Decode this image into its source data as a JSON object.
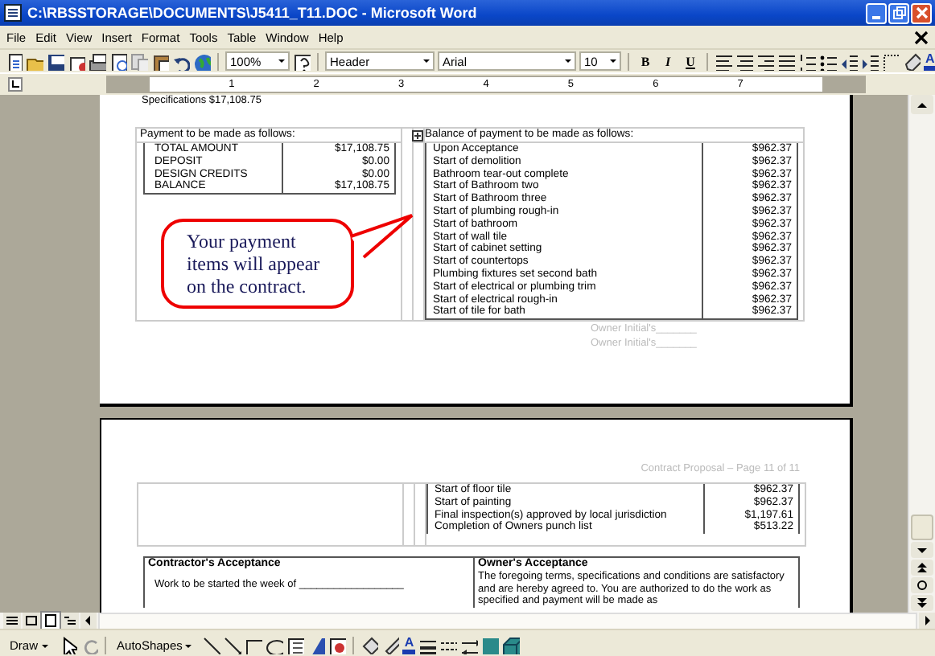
{
  "window": {
    "title": "C:\\RBSSTORAGE\\DOCUMENTS\\J5411_T11.DOC - Microsoft Word"
  },
  "menu": [
    "File",
    "Edit",
    "View",
    "Insert",
    "Format",
    "Tools",
    "Table",
    "Window",
    "Help"
  ],
  "toolbar": {
    "zoom": "100%",
    "style": "Header",
    "font": "Arial",
    "size": "10",
    "format_buttons": [
      "B",
      "I",
      "U"
    ],
    "font_color_label": "A"
  },
  "ruler": {
    "numbers": [
      "1",
      "2",
      "3",
      "4",
      "5",
      "6",
      "7"
    ]
  },
  "page1": {
    "specifications": "Specifications   $17,108.75",
    "payment_heading": "Payment to be made as follows:",
    "payment_rows": [
      {
        "label": "TOTAL AMOUNT",
        "amount": "$17,108.75"
      },
      {
        "label": "DEPOSIT",
        "amount": "$0.00"
      },
      {
        "label": "DESIGN CREDITS",
        "amount": "$0.00"
      },
      {
        "label": "BALANCE",
        "amount": "$17,108.75"
      }
    ],
    "balance_heading": "Balance of payment to be made as follows:",
    "balance_rows": [
      {
        "label": "Upon Acceptance",
        "amount": "$962.37"
      },
      {
        "label": "Start of demolition",
        "amount": "$962.37"
      },
      {
        "label": "Bathroom tear-out complete",
        "amount": "$962.37"
      },
      {
        "label": "Start of Bathroom two",
        "amount": "$962.37"
      },
      {
        "label": "Start of Bathroom three",
        "amount": "$962.37"
      },
      {
        "label": "Start of plumbing rough-in",
        "amount": "$962.37"
      },
      {
        "label": "Start of bathroom",
        "amount": "$962.37"
      },
      {
        "label": "Start of wall tile",
        "amount": "$962.37"
      },
      {
        "label": "Start of cabinet setting",
        "amount": "$962.37"
      },
      {
        "label": "Start of countertops",
        "amount": "$962.37"
      },
      {
        "label": "Plumbing fixtures set second bath",
        "amount": "$962.37"
      },
      {
        "label": "Start of electrical or plumbing trim",
        "amount": "$962.37"
      },
      {
        "label": "Start of electrical rough-in",
        "amount": "$962.37"
      },
      {
        "label": "Start of tile for bath",
        "amount": "$962.37"
      }
    ],
    "owner_initials": [
      "Owner Initial's_______",
      "Owner Initial's_______"
    ],
    "callout": "Your payment items will appear on the contract."
  },
  "page2": {
    "footer": "Contract Proposal – Page 11 of 11",
    "balance_rows": [
      {
        "label": "Start of floor tile",
        "amount": "$962.37"
      },
      {
        "label": "Start of painting",
        "amount": "$962.37"
      },
      {
        "label": "Final inspection(s) approved by local jurisdiction",
        "amount": "$1,197.61"
      },
      {
        "label": "Completion of Owners punch list",
        "amount": "$513.22"
      }
    ],
    "contractor": {
      "title": "Contractor's Acceptance",
      "text": "Work to be started the week of __________________"
    },
    "owner": {
      "title": "Owner's Acceptance",
      "text": "The foregoing terms, specifications and conditions are satisfactory and are hereby agreed to.  You are authorized to do the work as specified and payment will be made as"
    }
  },
  "drawing_toolbar": {
    "draw": "Draw",
    "autoshapes": "AutoShapes",
    "font_color_label": "A"
  }
}
